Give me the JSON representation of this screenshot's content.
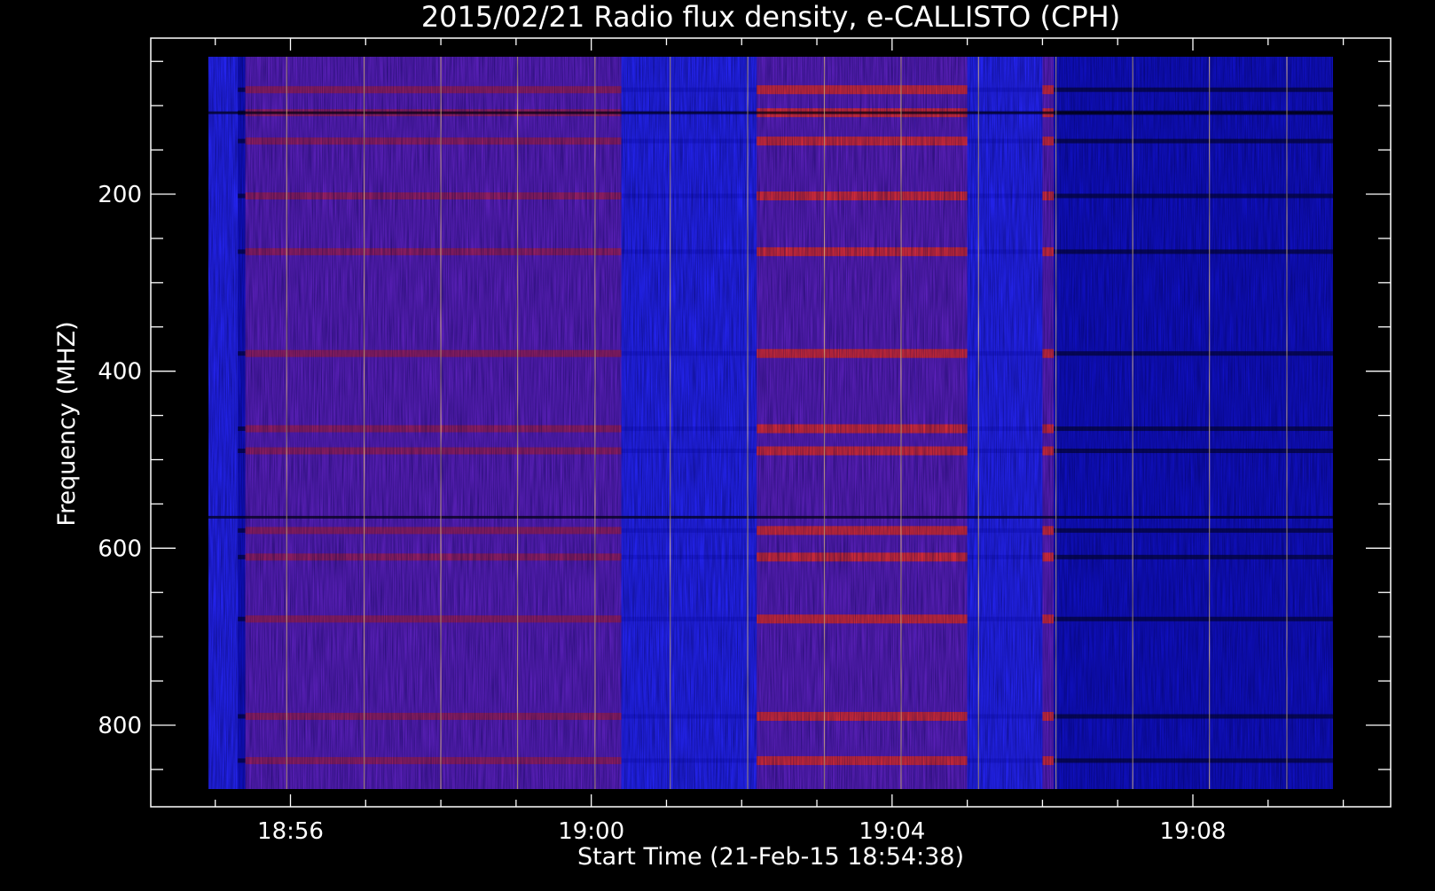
{
  "chart_data": {
    "type": "heatmap",
    "title": "2015/02/21  Radio flux density, e-CALLISTO (CPH)",
    "xlabel": "Start Time (21-Feb-15 18:54:38)",
    "ylabel": "Frequency (MHZ)",
    "x_ticks": [
      {
        "label": "18:56",
        "minutes": 56
      },
      {
        "label": "19:00",
        "minutes": 60
      },
      {
        "label": "19:04",
        "minutes": 64
      },
      {
        "label": "19:08",
        "minutes": 68
      }
    ],
    "y_ticks": [
      200,
      400,
      600,
      800
    ],
    "xlim_minutes": [
      54.63,
      70.0
    ],
    "ylim_mhz": [
      45,
      870
    ],
    "y_inverted": true,
    "colors": {
      "background": "#000000",
      "axis": "#ffffff",
      "base": "#2424ee",
      "dark_blue": "#1010c0",
      "purple": "#5a20b8",
      "red": "#d02010",
      "bright_red": "#ff3010",
      "black_line": "#000000",
      "spike": "#ffd880"
    },
    "regions": [
      {
        "t0": 55.3,
        "t1": 55.4,
        "level": "dark"
      },
      {
        "t0": 55.4,
        "t1": 60.4,
        "level": "purple"
      },
      {
        "t0": 60.4,
        "t1": 62.2,
        "level": "base"
      },
      {
        "t0": 62.2,
        "t1": 63.4,
        "level": "red"
      },
      {
        "t0": 63.4,
        "t1": 64.3,
        "level": "red"
      },
      {
        "t0": 64.3,
        "t1": 65.0,
        "level": "red"
      },
      {
        "t0": 65.0,
        "t1": 66.0,
        "level": "base"
      },
      {
        "t0": 66.0,
        "t1": 66.15,
        "level": "red"
      },
      {
        "t0": 66.15,
        "t1": 70.0,
        "level": "dark"
      }
    ],
    "freq_bands_mhz": [
      82,
      108,
      140,
      202,
      265,
      380,
      465,
      490,
      580,
      610,
      680,
      790,
      840
    ],
    "spikes_minutes": [
      55.95,
      56.98,
      58.0,
      59.02,
      60.05,
      61.05,
      62.08,
      63.1,
      64.12,
      65.15,
      66.18,
      67.2,
      68.22,
      69.25
    ]
  }
}
